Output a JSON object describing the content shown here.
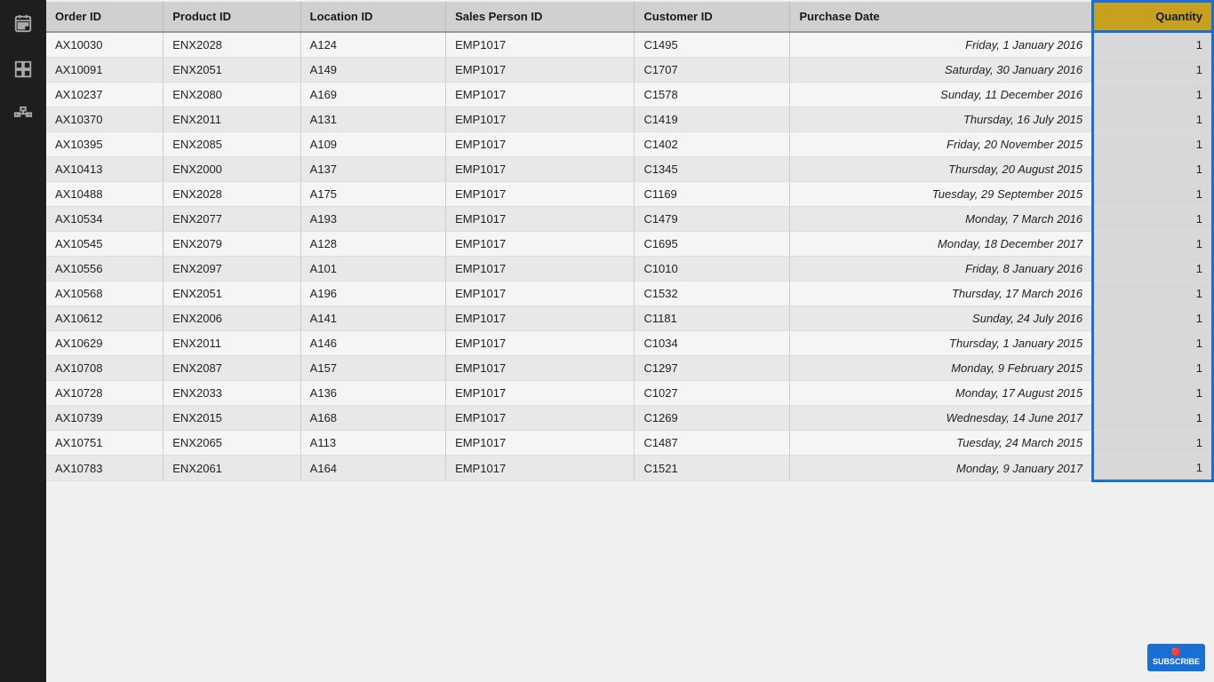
{
  "sidebar": {
    "icons": [
      {
        "name": "calendar-icon",
        "symbol": "📅"
      },
      {
        "name": "table-icon",
        "symbol": "⊞"
      },
      {
        "name": "hierarchy-icon",
        "symbol": "⊟"
      }
    ]
  },
  "table": {
    "columns": [
      {
        "id": "order_id",
        "label": "Order ID"
      },
      {
        "id": "product_id",
        "label": "Product ID"
      },
      {
        "id": "location_id",
        "label": "Location ID"
      },
      {
        "id": "sales_person_id",
        "label": "Sales Person ID"
      },
      {
        "id": "customer_id",
        "label": "Customer ID"
      },
      {
        "id": "purchase_date",
        "label": "Purchase Date"
      },
      {
        "id": "quantity",
        "label": "Quantity"
      }
    ],
    "rows": [
      {
        "order_id": "AX10030",
        "product_id": "ENX2028",
        "location_id": "A124",
        "sales_person_id": "EMP1017",
        "customer_id": "C1495",
        "purchase_date": "Friday, 1 January 2016",
        "quantity": "1"
      },
      {
        "order_id": "AX10091",
        "product_id": "ENX2051",
        "location_id": "A149",
        "sales_person_id": "EMP1017",
        "customer_id": "C1707",
        "purchase_date": "Saturday, 30 January 2016",
        "quantity": "1"
      },
      {
        "order_id": "AX10237",
        "product_id": "ENX2080",
        "location_id": "A169",
        "sales_person_id": "EMP1017",
        "customer_id": "C1578",
        "purchase_date": "Sunday, 11 December 2016",
        "quantity": "1"
      },
      {
        "order_id": "AX10370",
        "product_id": "ENX2011",
        "location_id": "A131",
        "sales_person_id": "EMP1017",
        "customer_id": "C1419",
        "purchase_date": "Thursday, 16 July 2015",
        "quantity": "1"
      },
      {
        "order_id": "AX10395",
        "product_id": "ENX2085",
        "location_id": "A109",
        "sales_person_id": "EMP1017",
        "customer_id": "C1402",
        "purchase_date": "Friday, 20 November 2015",
        "quantity": "1"
      },
      {
        "order_id": "AX10413",
        "product_id": "ENX2000",
        "location_id": "A137",
        "sales_person_id": "EMP1017",
        "customer_id": "C1345",
        "purchase_date": "Thursday, 20 August 2015",
        "quantity": "1"
      },
      {
        "order_id": "AX10488",
        "product_id": "ENX2028",
        "location_id": "A175",
        "sales_person_id": "EMP1017",
        "customer_id": "C1169",
        "purchase_date": "Tuesday, 29 September 2015",
        "quantity": "1"
      },
      {
        "order_id": "AX10534",
        "product_id": "ENX2077",
        "location_id": "A193",
        "sales_person_id": "EMP1017",
        "customer_id": "C1479",
        "purchase_date": "Monday, 7 March 2016",
        "quantity": "1"
      },
      {
        "order_id": "AX10545",
        "product_id": "ENX2079",
        "location_id": "A128",
        "sales_person_id": "EMP1017",
        "customer_id": "C1695",
        "purchase_date": "Monday, 18 December 2017",
        "quantity": "1"
      },
      {
        "order_id": "AX10556",
        "product_id": "ENX2097",
        "location_id": "A101",
        "sales_person_id": "EMP1017",
        "customer_id": "C1010",
        "purchase_date": "Friday, 8 January 2016",
        "quantity": "1"
      },
      {
        "order_id": "AX10568",
        "product_id": "ENX2051",
        "location_id": "A196",
        "sales_person_id": "EMP1017",
        "customer_id": "C1532",
        "purchase_date": "Thursday, 17 March 2016",
        "quantity": "1"
      },
      {
        "order_id": "AX10612",
        "product_id": "ENX2006",
        "location_id": "A141",
        "sales_person_id": "EMP1017",
        "customer_id": "C1181",
        "purchase_date": "Sunday, 24 July 2016",
        "quantity": "1"
      },
      {
        "order_id": "AX10629",
        "product_id": "ENX2011",
        "location_id": "A146",
        "sales_person_id": "EMP1017",
        "customer_id": "C1034",
        "purchase_date": "Thursday, 1 January 2015",
        "quantity": "1"
      },
      {
        "order_id": "AX10708",
        "product_id": "ENX2087",
        "location_id": "A157",
        "sales_person_id": "EMP1017",
        "customer_id": "C1297",
        "purchase_date": "Monday, 9 February 2015",
        "quantity": "1"
      },
      {
        "order_id": "AX10728",
        "product_id": "ENX2033",
        "location_id": "A136",
        "sales_person_id": "EMP1017",
        "customer_id": "C1027",
        "purchase_date": "Monday, 17 August 2015",
        "quantity": "1"
      },
      {
        "order_id": "AX10739",
        "product_id": "ENX2015",
        "location_id": "A168",
        "sales_person_id": "EMP1017",
        "customer_id": "C1269",
        "purchase_date": "Wednesday, 14 June 2017",
        "quantity": "1"
      },
      {
        "order_id": "AX10751",
        "product_id": "ENX2065",
        "location_id": "A113",
        "sales_person_id": "EMP1017",
        "customer_id": "C1487",
        "purchase_date": "Tuesday, 24 March 2015",
        "quantity": "1"
      },
      {
        "order_id": "AX10783",
        "product_id": "ENX2061",
        "location_id": "A164",
        "sales_person_id": "EMP1017",
        "customer_id": "C1521",
        "purchase_date": "Monday, 9 January 2017",
        "quantity": "1"
      }
    ]
  },
  "subscribe": {
    "label": "SUBSCRIBE"
  }
}
